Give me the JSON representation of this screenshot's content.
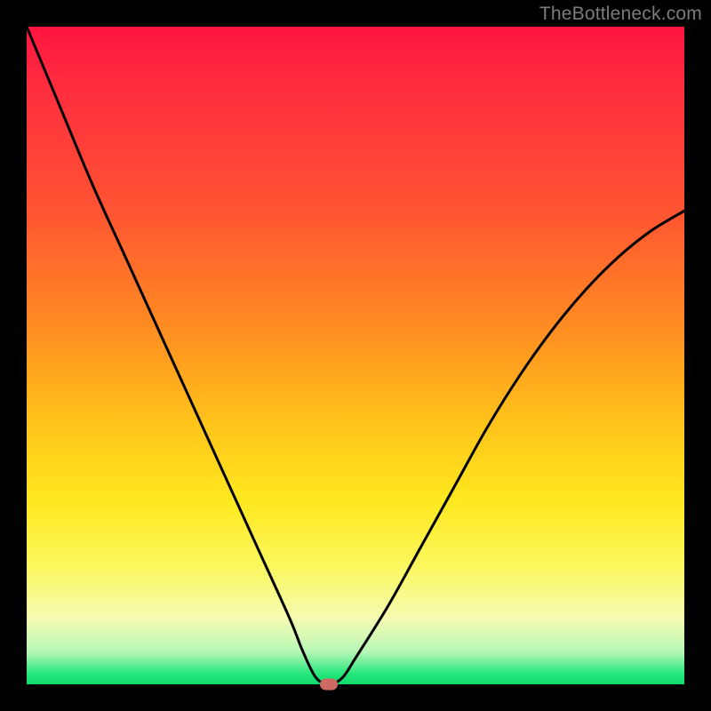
{
  "watermark": "TheBottleneck.com",
  "colors": {
    "frame": "#000000",
    "curve_stroke": "#000000",
    "marker_fill": "#cf6a63",
    "gradient_stops": [
      "#ff1540",
      "#ff2a3f",
      "#ff5432",
      "#ff8a22",
      "#ffc21a",
      "#ffe81e",
      "#fbf85e",
      "#f5fbb2",
      "#b8f7b6",
      "#22e67a",
      "#12d86a"
    ]
  },
  "chart_data": {
    "type": "line",
    "title": "",
    "xlabel": "",
    "ylabel": "",
    "xlim": [
      0,
      100
    ],
    "ylim": [
      0,
      100
    ],
    "grid": false,
    "legend": false,
    "series": [
      {
        "name": "bottleneck-curve",
        "x": [
          0,
          5,
          10,
          15,
          20,
          25,
          30,
          35,
          40,
          42,
          44,
          46,
          48,
          50,
          55,
          60,
          65,
          70,
          75,
          80,
          85,
          90,
          95,
          100
        ],
        "y": [
          100,
          88,
          76,
          65,
          54,
          43,
          32,
          21,
          10,
          5,
          1,
          0,
          1,
          4,
          12,
          21,
          30,
          39,
          47,
          54,
          60,
          65,
          69,
          72
        ]
      }
    ],
    "marker": {
      "x": 46,
      "y": 0,
      "label": ""
    }
  }
}
